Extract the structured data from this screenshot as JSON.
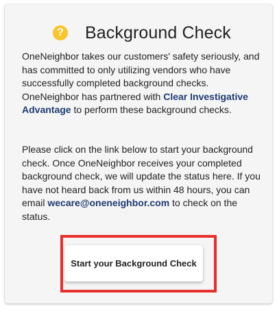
{
  "card": {
    "title": "Background Check",
    "help_icon_glyph": "?",
    "help_icon_color": "#f7c52c"
  },
  "paragraph1": {
    "text_before": "OneNeighbor takes our customers' safety seriously, and has committed to only utilizing vendors who have successfully completed background checks. OneNeighbor has partnered with ",
    "link_text": "Clear Investigative Advantage",
    "text_after": " to perform these background checks."
  },
  "paragraph2": {
    "text_before": "Please click on the link below to start your background check. Once OneNeighbor receives your completed background check, we will update the status here. If you have not heard back from us within 48 hours, you can email ",
    "email_link": "wecare@oneneighbor.com",
    "text_after": " to check on the status."
  },
  "button": {
    "label": "Start your Background Check"
  },
  "colors": {
    "link": "#1e3a73",
    "highlight_border": "#e8302a"
  }
}
